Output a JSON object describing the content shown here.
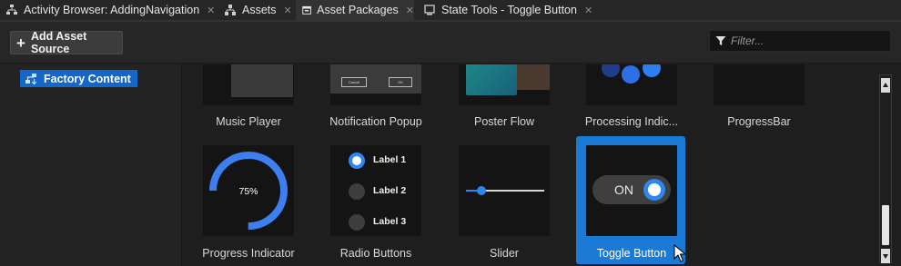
{
  "tabs": [
    {
      "label": "Activity Browser: AddingNavigation",
      "icon": "hierarchy-icon",
      "closable": true
    },
    {
      "label": "Assets",
      "icon": "tree-icon",
      "closable": true
    },
    {
      "label": "Asset Packages",
      "icon": "package-icon",
      "closable": true,
      "active": true
    },
    {
      "label": "State Tools - Toggle Button",
      "icon": "monitor-icon",
      "closable": true
    }
  ],
  "toolbar": {
    "add_source_label": "Add Asset Source",
    "filter_placeholder": "Filter..."
  },
  "tree": {
    "items": [
      {
        "label": "Factory Content",
        "icon": "factory-content-icon",
        "selected": true
      }
    ]
  },
  "assets": {
    "row1": [
      {
        "label": "Music Player"
      },
      {
        "label": "Notification Popup",
        "buttons": [
          "Cancel",
          "OK"
        ]
      },
      {
        "label": "Poster Flow"
      },
      {
        "label": "Processing Indic..."
      },
      {
        "label": "ProgressBar"
      }
    ],
    "row2": [
      {
        "label": "Progress Indicator",
        "value_text": "75%",
        "progress": 0.75
      },
      {
        "label": "Radio Buttons",
        "options": [
          "Label 1",
          "Label 2",
          "Label 3"
        ],
        "selected_index": 0
      },
      {
        "label": "Slider",
        "slider_value": 0.2
      },
      {
        "label": "Toggle Button",
        "toggle_text": "ON",
        "toggle_on": true,
        "selected": true
      }
    ]
  },
  "colors": {
    "accent": "#1a7ad6",
    "tree_selected": "#1466c8",
    "progress_ring": "#3d7ff0",
    "radio_selected": "#2e86f2"
  }
}
